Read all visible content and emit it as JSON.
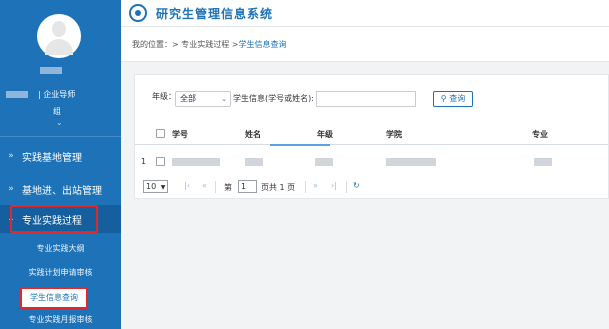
{
  "app": {
    "title": "研究生管理信息系统"
  },
  "user": {
    "role_text": "| 企业导师",
    "role_text_wrap": "组"
  },
  "sidebar": {
    "menus": [
      {
        "label": "实践基地管理"
      },
      {
        "label": "基地进、出站管理"
      },
      {
        "label": "专业实践过程"
      }
    ],
    "submenus": [
      {
        "label": "专业实践大纲"
      },
      {
        "label": "实践计划申请审核"
      },
      {
        "label": "学生信息查询"
      },
      {
        "label": "专业实践月报审核"
      }
    ]
  },
  "breadcrumb": {
    "prefix": "我的位置：",
    "path": " > 专业实践过程 > ",
    "current": "学生信息查询"
  },
  "filter": {
    "grade_label": "年级：",
    "grade_value": "全部",
    "query_label": "学生信息(学号或姓名):",
    "query_value": "",
    "search_button": "查询"
  },
  "table": {
    "headers": [
      "学号",
      "姓名",
      "年级",
      "学院",
      "专业"
    ],
    "rows": [
      {
        "index": "1"
      }
    ]
  },
  "pager": {
    "page_size": "10",
    "page_prefix": "第",
    "page_value": "1",
    "page_suffix": "页共 1 页"
  },
  "colors": {
    "primary": "#1e73b8",
    "highlight_box": "#e02a2a",
    "background": "#f2f3f5"
  },
  "icons": {
    "logo": "university-seal-icon",
    "menu_arrow": "double-chevron-right-icon",
    "expanded": "chevron-down-icon",
    "search": "search-icon",
    "refresh": "refresh-icon"
  }
}
